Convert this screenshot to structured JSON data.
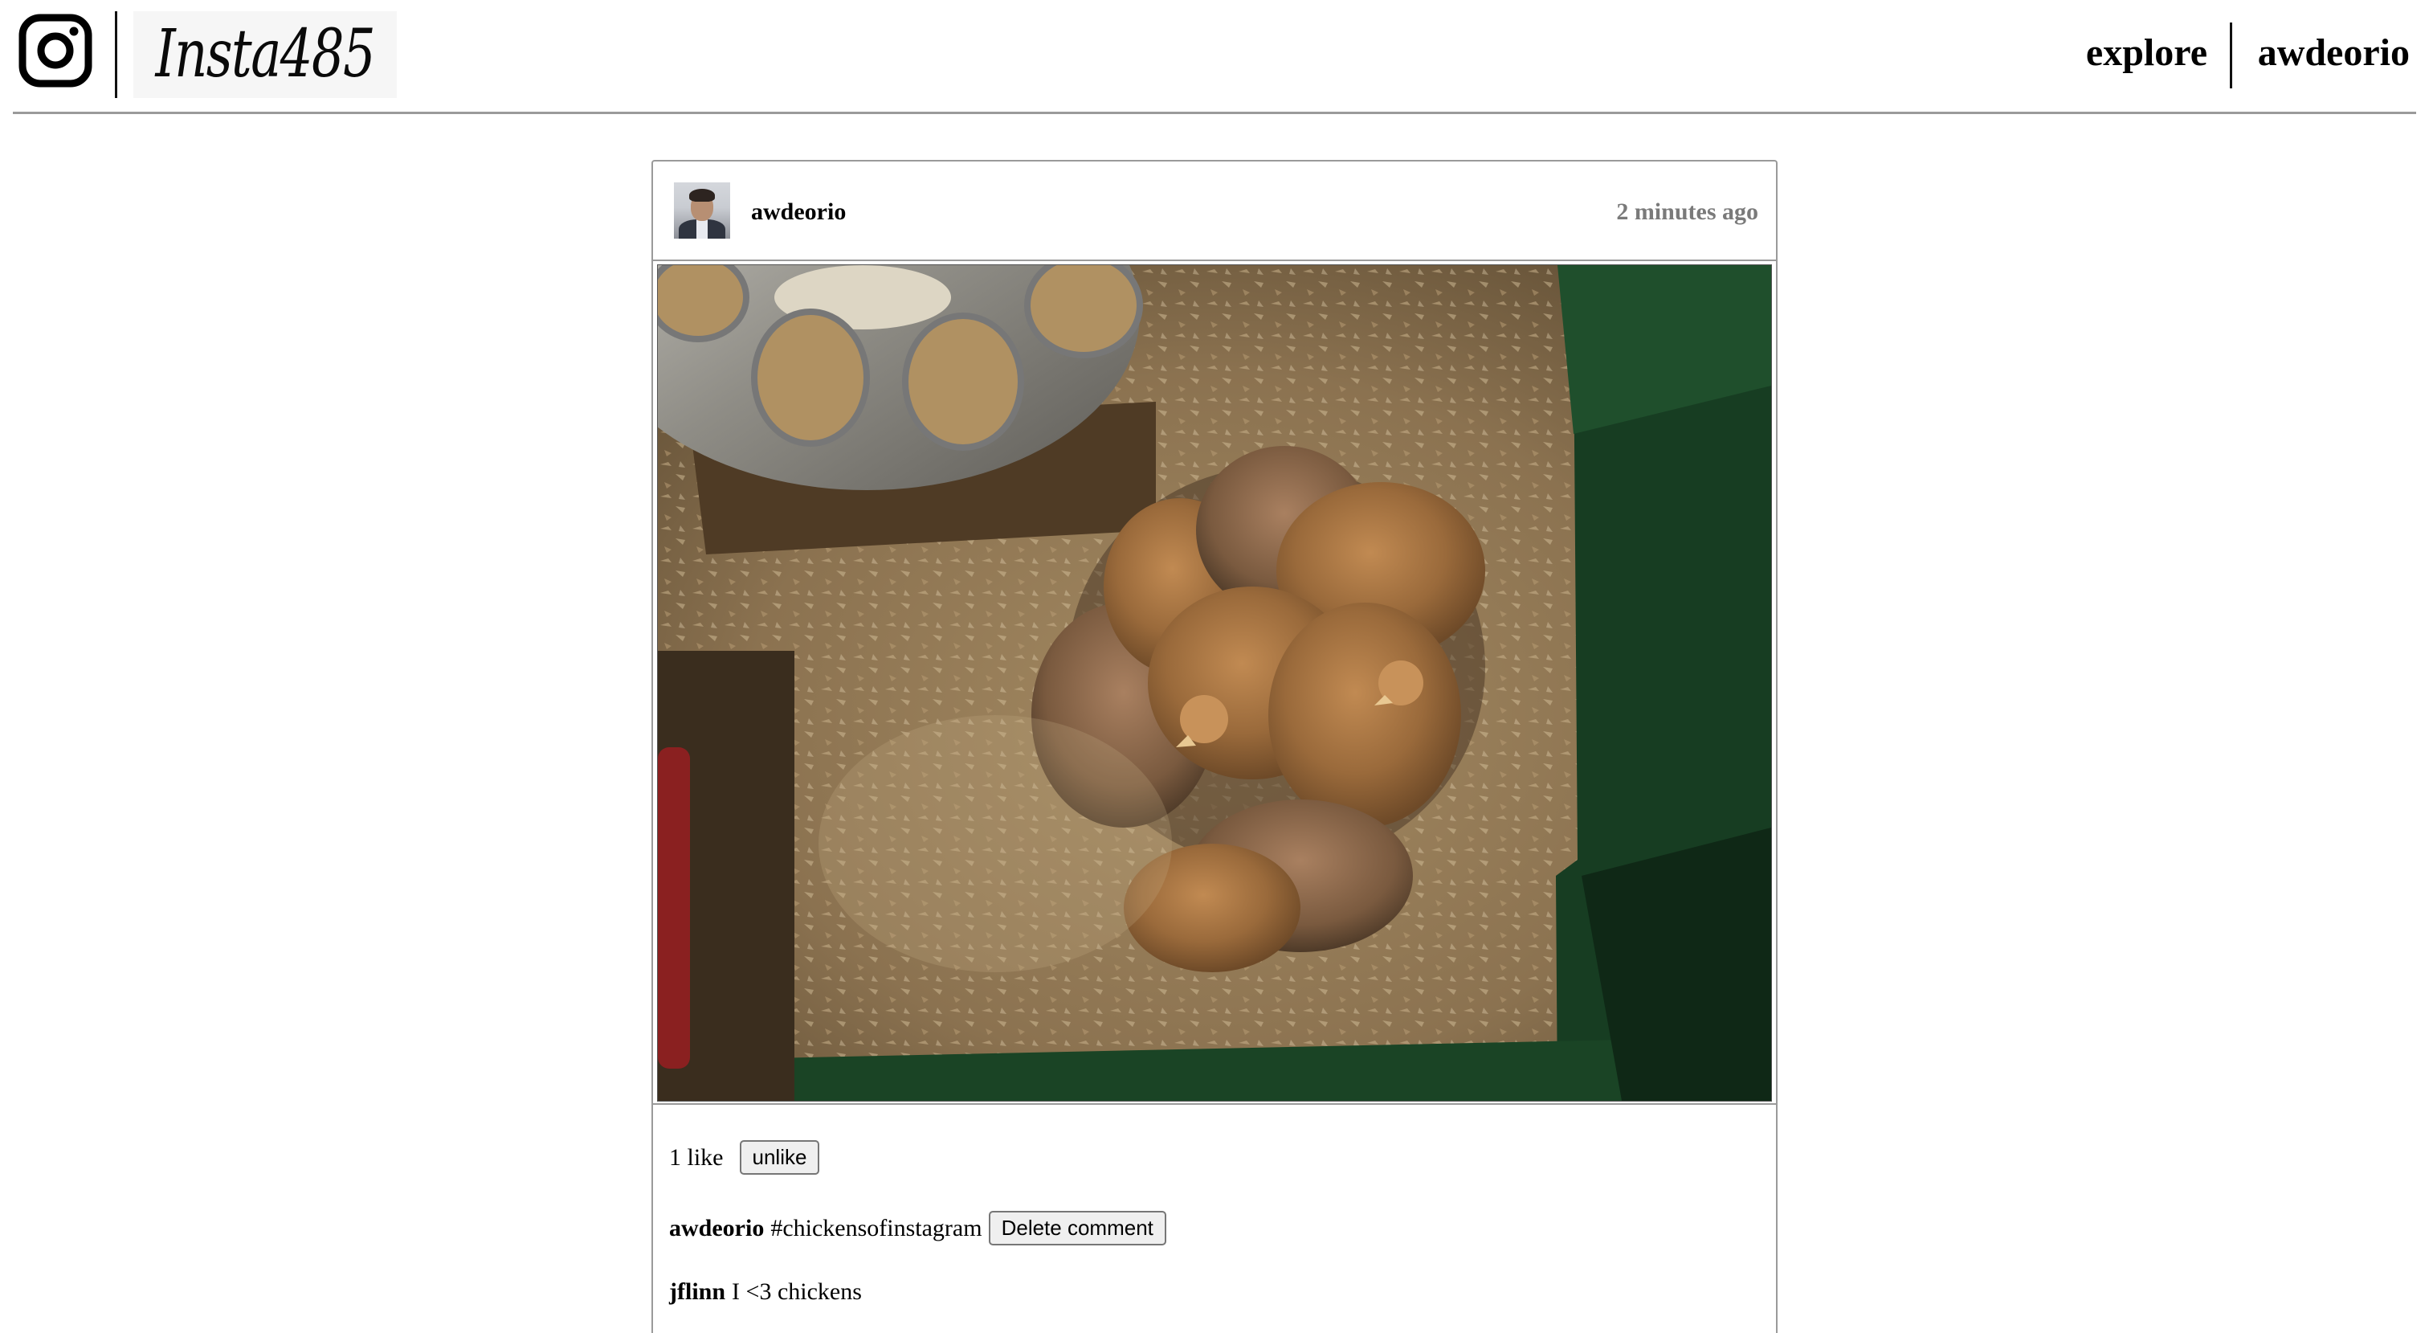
{
  "header": {
    "logo_text": "Insta485",
    "nav": {
      "explore_label": "explore",
      "user_label": "awdeorio"
    }
  },
  "icons": {
    "camera": "instagram-camera-icon",
    "avatar": "avatar"
  },
  "post": {
    "owner": "awdeorio",
    "timestamp": "2 minutes ago",
    "image_description": "",
    "likes_text": "1 like",
    "like_button_label": "unlike",
    "comments": [
      {
        "owner": "awdeorio",
        "text": "#chickensofinstagram",
        "delete_label": "Delete comment"
      },
      {
        "owner": "jflinn",
        "text": "I <3 chickens"
      }
    ]
  },
  "colors": {
    "rule": "#9a9a9a",
    "timestamp": "#7a7a7a",
    "button_bg": "#efefef"
  }
}
